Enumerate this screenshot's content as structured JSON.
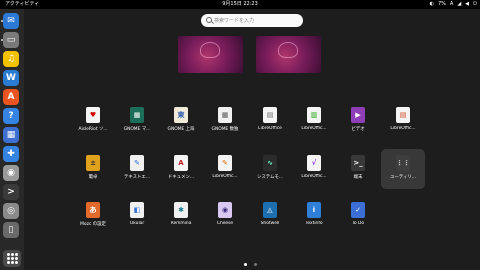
{
  "topbar": {
    "activities": "アクティビティ",
    "clock": "9月15日  22:23",
    "battery": "7%",
    "input_method": "A"
  },
  "search": {
    "placeholder": "検索ワードを入力"
  },
  "dock": {
    "items": [
      {
        "name": "thunderbird-icon",
        "color": "#2c7ad6",
        "glyph": "✉"
      },
      {
        "name": "files-icon",
        "color": "#7a7a7a",
        "glyph": "▭"
      },
      {
        "name": "rhythmbox-icon",
        "color": "#f2c200",
        "glyph": "♫"
      },
      {
        "name": "libreoffice-writer-icon",
        "color": "#2a7bd3",
        "glyph": "W"
      },
      {
        "name": "app-center-icon",
        "color": "#e95420",
        "glyph": "A"
      },
      {
        "name": "help-icon",
        "color": "#3584e4",
        "glyph": "?"
      },
      {
        "name": "calendar-icon",
        "color": "#3d6fd0",
        "glyph": "▦"
      },
      {
        "name": "extension-icon",
        "color": "#3584e4",
        "glyph": "✚"
      },
      {
        "name": "image-viewer-icon",
        "color": "#9a9a9a",
        "glyph": "◉"
      },
      {
        "name": "terminal-icon",
        "color": "#3a3a3a",
        "glyph": ">"
      },
      {
        "name": "disk-icon",
        "color": "#8a8a8a",
        "glyph": "◎"
      },
      {
        "name": "trash-icon",
        "color": "#6a6a6a",
        "glyph": "▯"
      }
    ]
  },
  "apps": [
    {
      "label": "AisleRiot ソ...",
      "color": "#f5f5f5",
      "glyph": "♥",
      "fg": "#d00000"
    },
    {
      "label": "GNOME マ...",
      "color": "#1b6f5a",
      "glyph": "▦",
      "fg": "#fff"
    },
    {
      "label": "GNOME 上海",
      "color": "#f0ead8",
      "glyph": "東",
      "fg": "#2a5ab0"
    },
    {
      "label": "GNOME 数独",
      "color": "#f0f0f0",
      "glyph": "▦",
      "fg": "#555"
    },
    {
      "label": "LibreOffice",
      "color": "#f4f4f4",
      "glyph": "▤",
      "fg": "#666"
    },
    {
      "label": "LibreOffic...",
      "color": "#f4f4f4",
      "glyph": "▥",
      "fg": "#18a303"
    },
    {
      "label": "ビデオ",
      "color": "#8f3fb6",
      "glyph": "▶",
      "fg": "#fff"
    },
    {
      "label": "LibreOffic...",
      "color": "#f4f4f4",
      "glyph": "▤",
      "fg": "#d2451e"
    },
    {
      "label": "電卓",
      "color": "#e0a21a",
      "glyph": "±",
      "fg": "#333"
    },
    {
      "label": "テキストエ...",
      "color": "#f0f0f0",
      "glyph": "✎",
      "fg": "#2a6ed6"
    },
    {
      "label": "ドキュメン...",
      "color": "#f4f4f4",
      "glyph": "A",
      "fg": "#c01c28"
    },
    {
      "label": "LibreOffic...",
      "color": "#f4f4f4",
      "glyph": "✎",
      "fg": "#e06c00"
    },
    {
      "label": "システムモ...",
      "color": "#2b2b2b",
      "glyph": "∿",
      "fg": "#6fc"
    },
    {
      "label": "LibreOffic...",
      "color": "#f4f4f4",
      "glyph": "√",
      "fg": "#8a2be2"
    },
    {
      "label": "端末",
      "color": "#383838",
      "glyph": ">_",
      "fg": "#fff"
    },
    {
      "label": "ユーティリ...",
      "color": "#3e3e3e",
      "glyph": "⋮⋮",
      "fg": "#bbb"
    },
    {
      "label": "Mozc の設定",
      "color": "#e36a2a",
      "glyph": "あ",
      "fg": "#fff"
    },
    {
      "label": "Okular",
      "color": "#f0f0f0",
      "glyph": "◧",
      "fg": "#3a6fd8"
    },
    {
      "label": "Remmina",
      "color": "#f0f0f0",
      "glyph": "✱",
      "fg": "#1a7a8a"
    },
    {
      "label": "Cheese",
      "color": "#d9c8f2",
      "glyph": "◉",
      "fg": "#3b2a7a"
    },
    {
      "label": "Shotwell",
      "color": "#1e6fb0",
      "glyph": "◬",
      "fg": "#fff"
    },
    {
      "label": "Textinfo",
      "color": "#2f7fd8",
      "glyph": "i",
      "fg": "#fff"
    },
    {
      "label": "To Do",
      "color": "#3c6fd6",
      "glyph": "✓",
      "fg": "#fff"
    }
  ]
}
